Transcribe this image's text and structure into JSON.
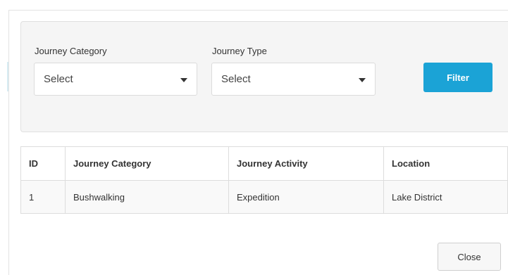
{
  "filters": {
    "category": {
      "label": "Journey Category",
      "value": "Select"
    },
    "type": {
      "label": "Journey Type",
      "value": "Select"
    },
    "filter_button_label": "Filter"
  },
  "table": {
    "columns": [
      "ID",
      "Journey Category",
      "Journey Activity",
      "Location"
    ],
    "rows": [
      [
        "1",
        "Bushwalking",
        "Expedition",
        "Lake District"
      ]
    ]
  },
  "footer": {
    "close_button_label": "Close"
  },
  "colors": {
    "accent": "#1ba3d6",
    "panel_background": "#f5f5f5"
  },
  "icons": {
    "select_caret": "caret-down-icon"
  }
}
